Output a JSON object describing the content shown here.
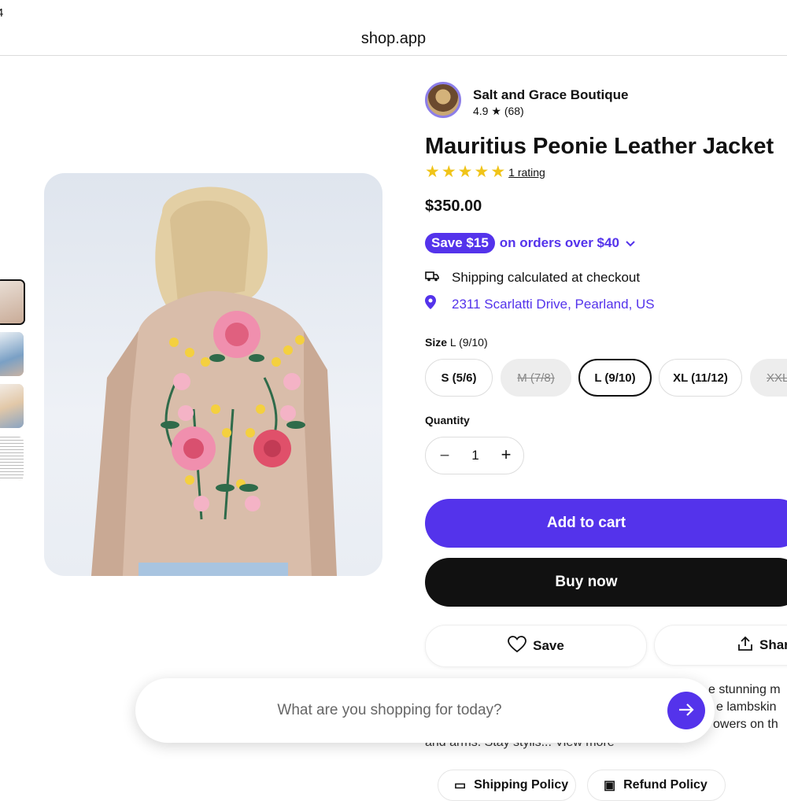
{
  "browser": {
    "domain": "shop.app",
    "cut_text": "4"
  },
  "shop": {
    "name": "Salt and Grace Boutique",
    "rating": "4.9",
    "reviews": "(68)"
  },
  "product": {
    "title": "Mauritius Peonie Leather Jacket",
    "rating_link": "1 rating",
    "stars": 5,
    "price": "$350.00"
  },
  "promo": {
    "badge": "Save $15",
    "text": "on orders over $40"
  },
  "shipping": {
    "text": "Shipping calculated at checkout",
    "location": "2311 Scarlatti Drive, Pearland, US"
  },
  "size": {
    "label": "Size",
    "selected": "L (9/10)",
    "options": [
      {
        "label": "S (5/6)",
        "state": "available"
      },
      {
        "label": "M (7/8)",
        "state": "sold-out"
      },
      {
        "label": "L (9/10)",
        "state": "selected"
      },
      {
        "label": "XL (11/12)",
        "state": "available"
      },
      {
        "label": "XXL",
        "state": "sold-out"
      }
    ]
  },
  "quantity": {
    "label": "Quantity",
    "value": "1"
  },
  "actions": {
    "add_to_cart": "Add to cart",
    "buy_now": "Buy now",
    "save": "Save",
    "share": "Shar"
  },
  "description": {
    "line1": "e stunning m",
    "line2": "e lambskin",
    "line3": "owers on th",
    "line4": "and arms. Stay stylis... View more"
  },
  "search": {
    "placeholder": "What are you shopping for today?"
  },
  "policies": {
    "shipping": "Shipping Policy",
    "refund": "Refund Policy"
  },
  "colors": {
    "accent": "#5433eb",
    "star": "#f0c419",
    "dark": "#111111"
  }
}
